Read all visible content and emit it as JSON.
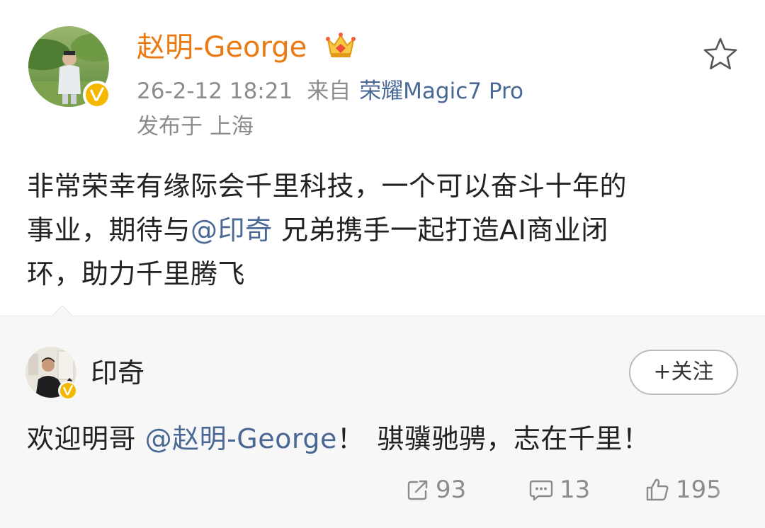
{
  "post": {
    "author_name": "赵明-George",
    "timestamp": "26-2-12 18:21",
    "from_label": "来自",
    "device": "荣耀Magic7 Pro",
    "location": "发布于 上海",
    "body": {
      "line1": "非常荣幸有缘际会千里科技，一个可以奋斗十年的",
      "line2_pre": "事业，期待与",
      "line2_mention": "@印奇",
      "line2_post": " 兄弟携手一起打造AI商业闭",
      "line3": "环，助力千里腾飞"
    },
    "icons": {
      "avatar": "avatar-icon",
      "verified": "verified-badge-icon",
      "crown": "crown-badge-icon",
      "favorite": "star-icon"
    }
  },
  "repost": {
    "author_name": "印奇",
    "follow_label": "+关注",
    "text_pre": "欢迎明哥 ",
    "mention": "@赵明-George",
    "text_mid": "！",
    "text_post": "骐骥驰骋，志在千里！",
    "actions": {
      "reposts": "93",
      "comments": "13",
      "likes": "195"
    },
    "icons": {
      "repost": "share-icon",
      "comment": "comment-icon",
      "like": "thumbs-up-icon"
    }
  },
  "colors": {
    "author_name": "#eb7a13",
    "link": "#4a6894",
    "meta": "#8c8c8c",
    "text": "#222222",
    "verified": "#f5b800",
    "repost_bg": "#f7f7f7"
  }
}
